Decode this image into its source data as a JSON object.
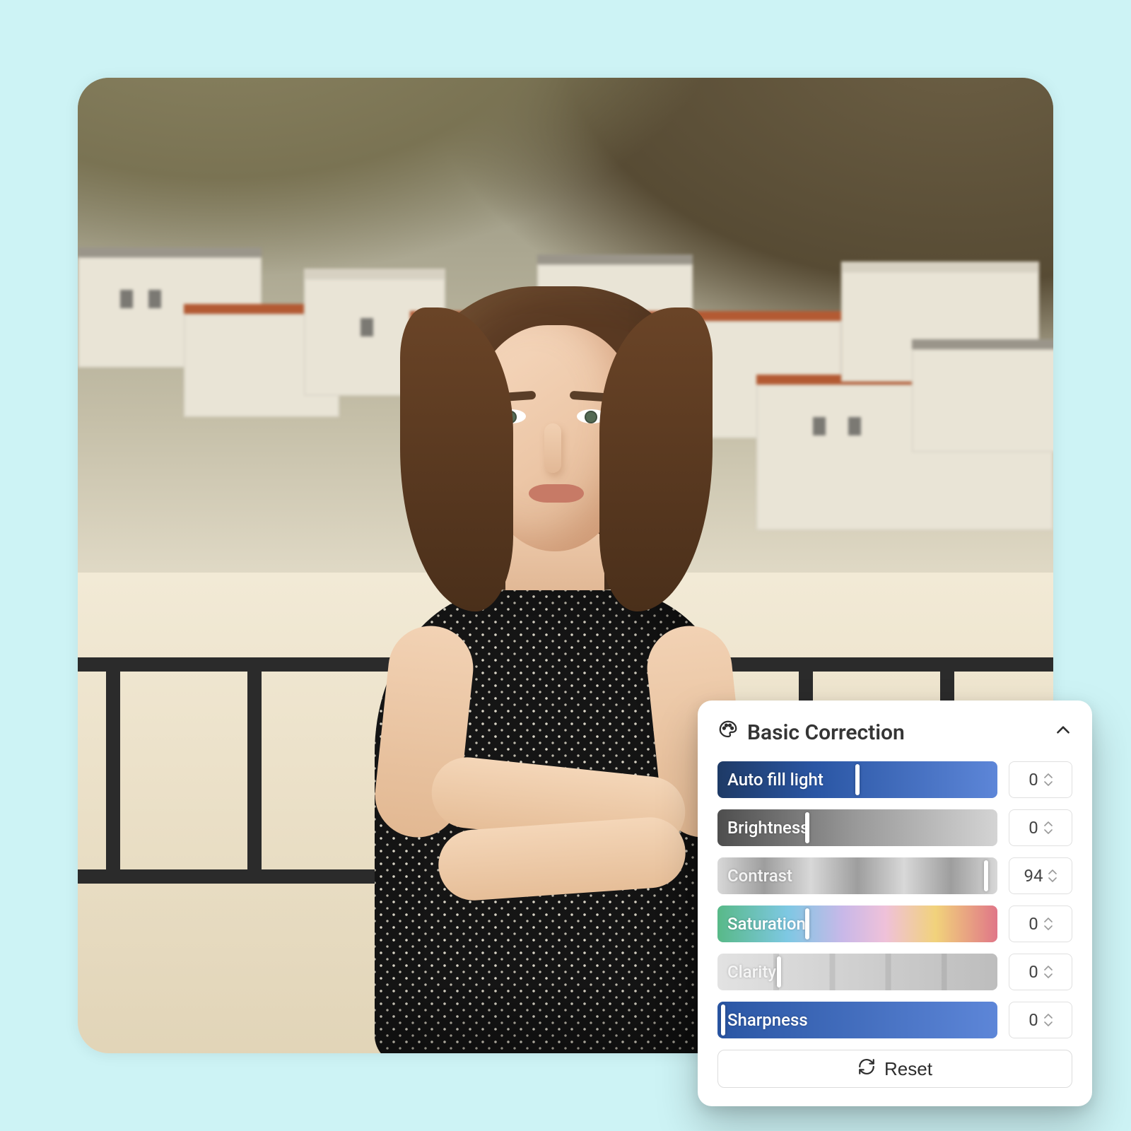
{
  "panel": {
    "title": "Basic Correction",
    "reset_label": "Reset",
    "sliders": [
      {
        "key": "autofill",
        "label": "Auto fill light",
        "value": 0,
        "thumb_pct": 50
      },
      {
        "key": "bright",
        "label": "Brightness",
        "value": 0,
        "thumb_pct": 32
      },
      {
        "key": "contrast",
        "label": "Contrast",
        "value": 94,
        "thumb_pct": 96
      },
      {
        "key": "satur",
        "label": "Saturation",
        "value": 0,
        "thumb_pct": 32
      },
      {
        "key": "clarity",
        "label": "Clarity",
        "value": 0,
        "thumb_pct": 22
      },
      {
        "key": "sharp",
        "label": "Sharpness",
        "value": 0,
        "thumb_pct": 2
      }
    ]
  },
  "colors": {
    "page_bg": "#cdf3f5",
    "panel_bg": "#ffffff",
    "text": "#353535"
  }
}
